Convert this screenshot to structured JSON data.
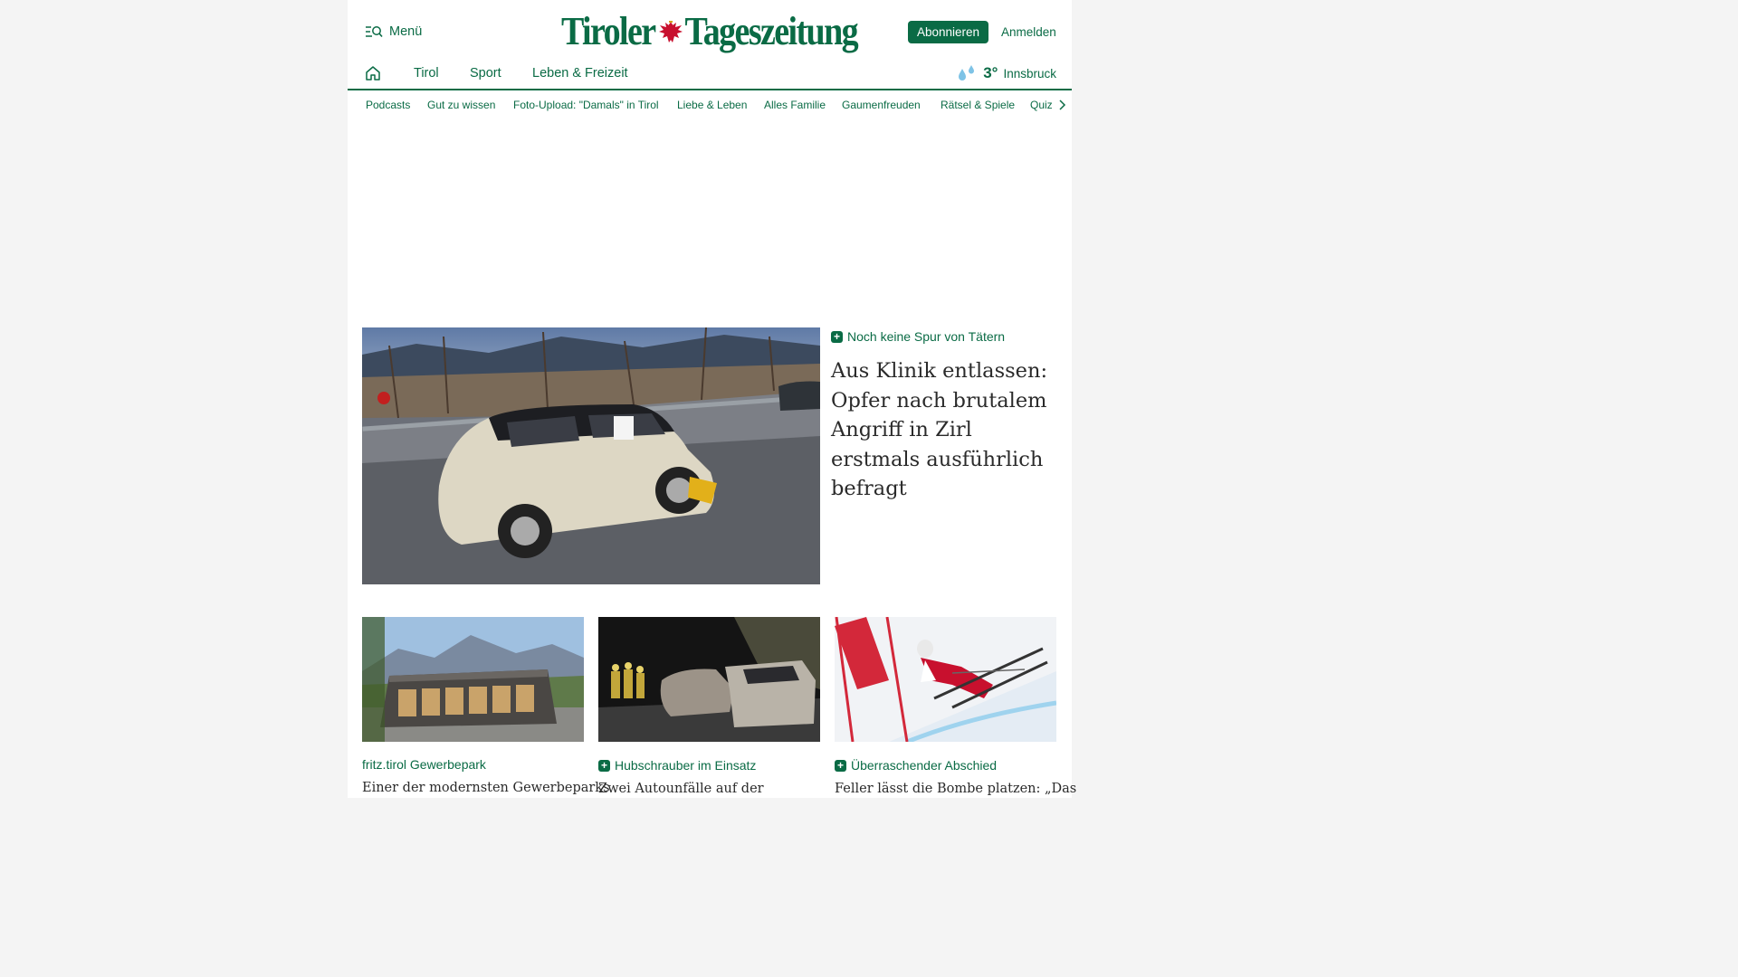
{
  "header": {
    "menu_label": "Menü",
    "logo_left": "Tiroler",
    "logo_right": "Tageszeitung",
    "subscribe_label": "Abonnieren",
    "login_label": "Anmelden"
  },
  "main_nav": {
    "items": [
      "Tirol",
      "Sport",
      "Leben & Freizeit"
    ],
    "weather": {
      "temp": "3°",
      "city": "Innsbruck",
      "icon": "rain-drops-icon"
    }
  },
  "sub_nav": {
    "items": [
      "Podcasts",
      "Gut zu wissen",
      "Foto-Upload: \"Damals\" in Tirol",
      "Liebe & Leben",
      "Alles Familie",
      "Gaumenfreuden",
      "Rätsel & Spiele",
      "Quiz"
    ]
  },
  "hero": {
    "kicker": "Noch keine Spur von Tätern",
    "title": "Aus Klinik entlassen: Opfer nach brutalem Angriff in Zirl erstmals ausführlich befragt"
  },
  "teasers": [
    {
      "kicker": "fritz.tirol Gewerbepark",
      "plus": false,
      "title": "Einer der modernsten Gewerbeparks"
    },
    {
      "kicker": "Hubschrauber im Einsatz",
      "plus": true,
      "title": "Zwei Autounfälle auf der"
    },
    {
      "kicker": "Überraschender Abschied",
      "plus": true,
      "title": "Feller lässt die Bombe platzen: „Das"
    }
  ],
  "colors": {
    "brand": "#0a6b45",
    "page_bg": "#f4f4f4"
  },
  "icons": {
    "menu": "menu-search-icon",
    "home": "home-icon",
    "plus": "plus-badge-icon",
    "chevron": "chevron-right-icon",
    "logo_emblem": "tyrolean-eagle-icon"
  }
}
